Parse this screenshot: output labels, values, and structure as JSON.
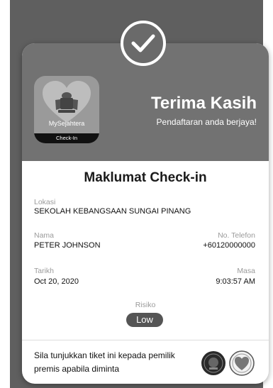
{
  "app": {
    "name": "MySejahtera",
    "strip_label": "Check-In"
  },
  "header": {
    "title": "Terima Kasih",
    "subtitle": "Pendaftaran anda berjaya!"
  },
  "section": {
    "title": "Maklumat Check-in"
  },
  "fields": {
    "location_label": "Lokasi",
    "location_value": "SEKOLAH KEBANGSAAN SUNGAI PINANG",
    "name_label": "Nama",
    "name_value": "PETER JOHNSON",
    "phone_label": "No. Telefon",
    "phone_value": "+60120000000",
    "date_label": "Tarikh",
    "date_value": "Oct 20, 2020",
    "time_label": "Masa",
    "time_value": "9:03:57 AM",
    "risk_label": "Risiko",
    "risk_value": "Low"
  },
  "footer": {
    "instruction": "Sila tunjukkan tiket ini kepada pemilik premis apabila diminta"
  },
  "colors": {
    "background": "#5f5f5f",
    "header": "#727272",
    "risk_pill": "#555555"
  }
}
